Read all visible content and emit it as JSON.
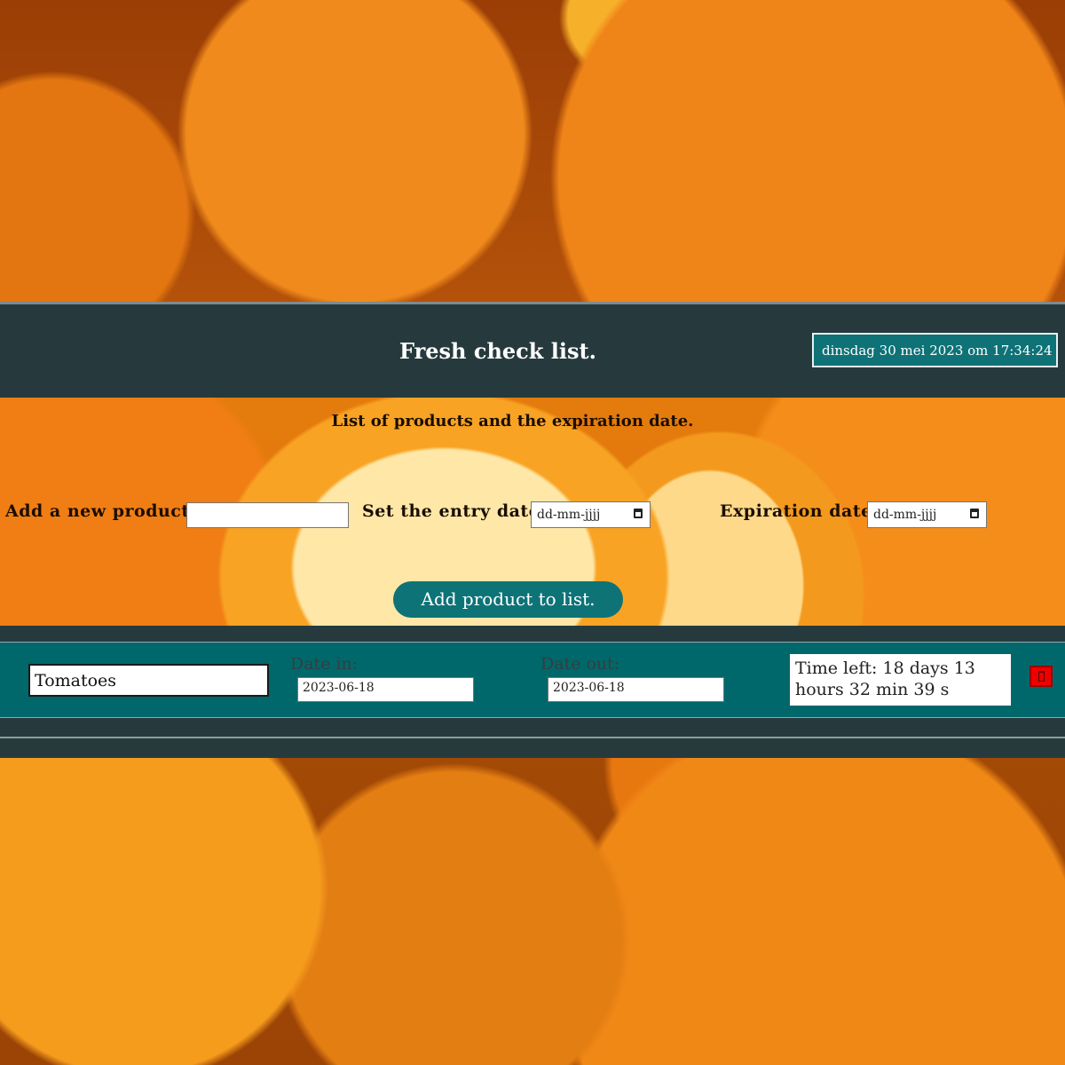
{
  "header": {
    "title": "Fresh check list.",
    "clock": "dinsdag 30 mei 2023 om 17:34:24"
  },
  "form": {
    "subtitle": "List of products and the expiration date.",
    "product_label": "Add a new product:",
    "product_value": "",
    "entry_date_label": "Set the entry date:",
    "entry_date_placeholder": "dd-mm-jjjj",
    "expiration_label": "Expiration date:",
    "expiration_placeholder": "dd-mm-jjjj",
    "add_button_label": "Add product to list."
  },
  "products": [
    {
      "name": "Tomatoes",
      "date_in_label": "Date in:",
      "date_in": "2023-06-18",
      "date_out_label": "Date out:",
      "date_out": "2023-06-18",
      "time_left": "Time left: 18 days 13 hours 32 min 39 s",
      "delete_icon": "trash-icon"
    }
  ],
  "colors": {
    "header_bg": "#263a3e",
    "accent": "#0d7377",
    "row_bg": "#00686b",
    "delete": "#ee0000",
    "background_theme": "oranges"
  }
}
